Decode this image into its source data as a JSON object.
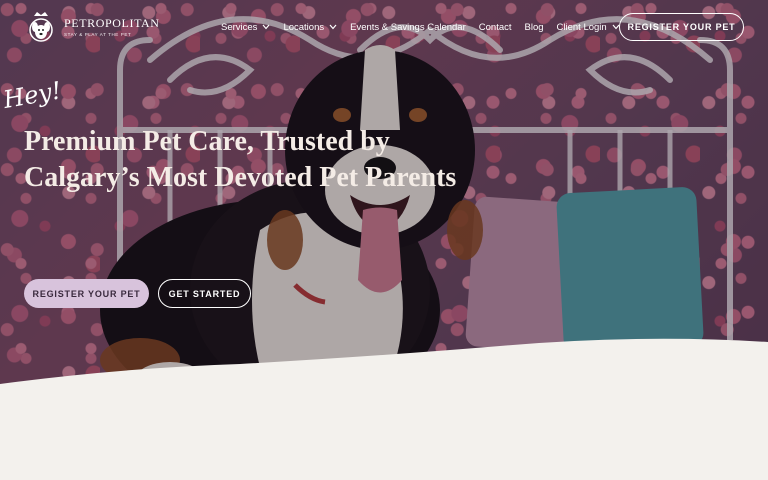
{
  "brand": {
    "name": "PETROPOLITAN",
    "tagline": "STAY & PLAY AT THE PET"
  },
  "nav": {
    "items": [
      {
        "label": "Services",
        "has_dropdown": true
      },
      {
        "label": "Locations",
        "has_dropdown": true
      },
      {
        "label": "Events & Savings Calendar",
        "has_dropdown": false
      },
      {
        "label": "Contact",
        "has_dropdown": false
      },
      {
        "label": "Blog",
        "has_dropdown": false
      },
      {
        "label": "Client Login",
        "has_dropdown": true
      }
    ],
    "cta_label": "REGISTER YOUR PET"
  },
  "hero": {
    "greeting": "Hey!",
    "headline_line1": "Premium Pet Care, Trusted by",
    "headline_line2": "Calgary’s Most Devoted Pet Parents",
    "primary_button": "REGISTER YOUR PET",
    "secondary_button": "GET STARTED"
  },
  "colors": {
    "primary_button_bg": "#d8c3dc",
    "page_bg": "#f3f1ed",
    "text_light": "#ffffff"
  }
}
